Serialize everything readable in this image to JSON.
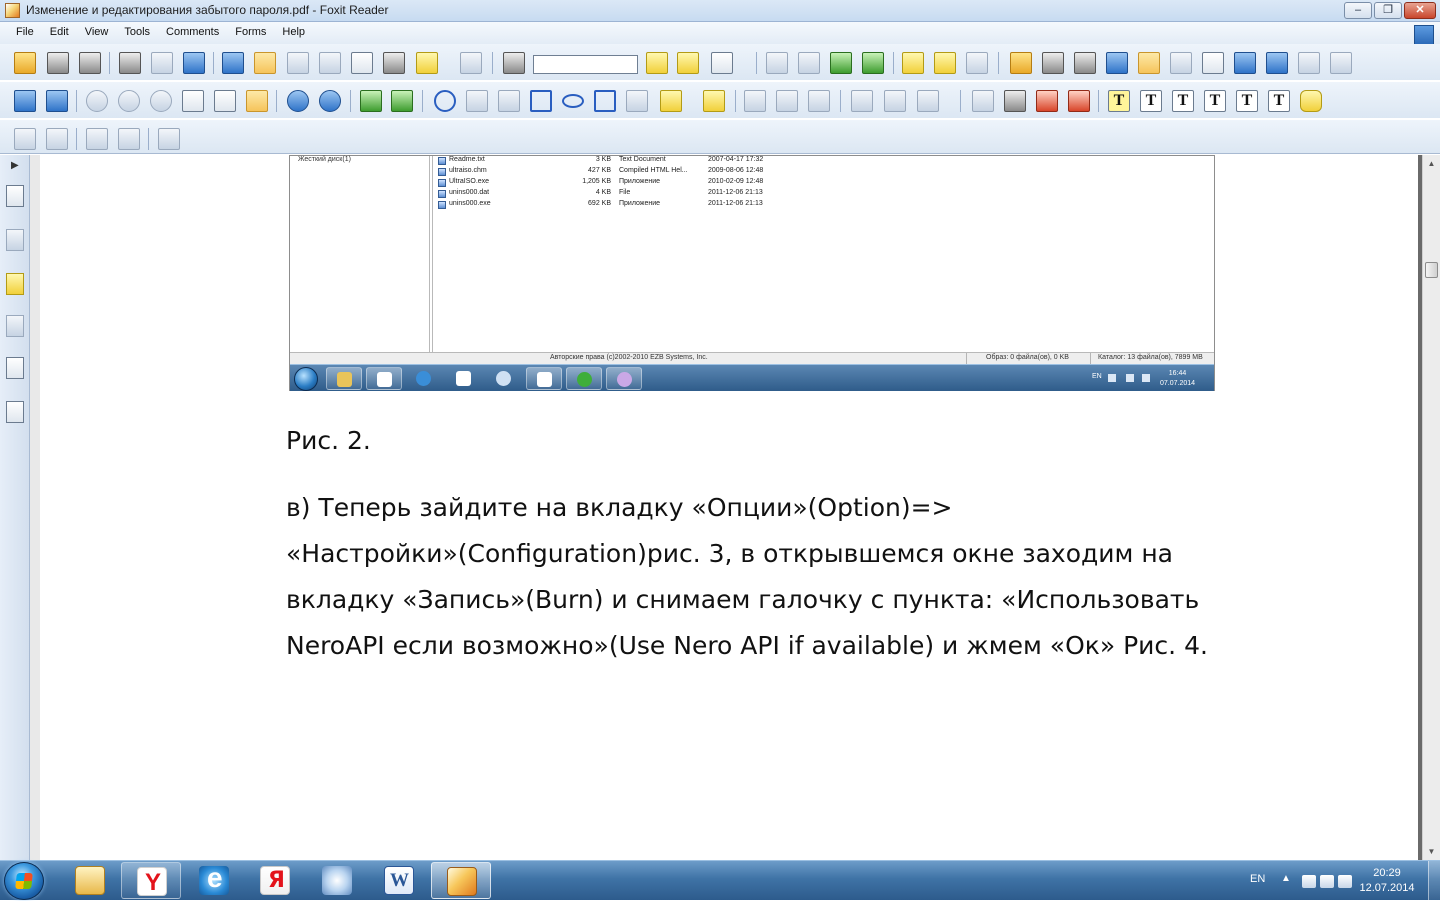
{
  "window": {
    "title": "Изменение и редактирования забытого пароля.pdf - Foxit Reader",
    "minimize": "–",
    "maximize": "❐",
    "close": "✕"
  },
  "menu": [
    "File",
    "Edit",
    "View",
    "Tools",
    "Comments",
    "Forms",
    "Help"
  ],
  "toolbar": {
    "search_value": "",
    "tool_icons": [
      "open-folder-icon",
      "save-icon",
      "save-all-icon",
      "print-icon",
      "email-icon",
      "facebook-icon",
      "monitor-icon",
      "hand-tool-icon",
      "snapshot-icon",
      "select-arrow-icon",
      "text-select-icon",
      "camera-icon",
      "rms-lock-icon",
      "sign-pen-icon",
      "binoculars-icon",
      "zoom-in-icon",
      "zoom-out-icon",
      "fit-page-icon",
      "rotate-icon",
      "circle-tool-icon",
      "arrow-tool-icon",
      "line-tool-icon",
      "rectangle-tool-icon",
      "oval-tool-icon",
      "polygon-tool-icon",
      "polyline-tool-icon",
      "pencil-tool-icon",
      "eraser-tool-icon",
      "typewriter-icon",
      "note-icon",
      "attachment-icon"
    ]
  },
  "text_tools": [
    "T",
    "T",
    "T",
    "T",
    "T",
    "T"
  ],
  "embedded_screenshot": {
    "tree_label": "Жесткий диск(1)",
    "files": [
      {
        "name": "Readme.txt",
        "size": "3 KB",
        "type": "Text Document",
        "date": "2007-04-17 17:32"
      },
      {
        "name": "ultraiso.chm",
        "size": "427 KB",
        "type": "Compiled HTML Hel...",
        "date": "2009-08-06 12:48"
      },
      {
        "name": "UltraISO.exe",
        "size": "1,205 KB",
        "type": "Приложение",
        "date": "2010-02-09 12:48"
      },
      {
        "name": "unins000.dat",
        "size": "4 KB",
        "type": "File",
        "date": "2011-12-06 21:13"
      },
      {
        "name": "unins000.exe",
        "size": "692 KB",
        "type": "Приложение",
        "date": "2011-12-06 21:13"
      }
    ],
    "status_copyright": "Авторские права (c)2002-2010 EZB Systems, Inc.",
    "status_image": "Образ: 0 файла(ов), 0 KB",
    "status_catalog": "Каталог: 13 файла(ов), 7899 MB",
    "tray_lang": "EN",
    "tray_time": "16:44",
    "tray_date": "07.07.2014"
  },
  "document": {
    "caption": "Рис. 2.",
    "paragraph_lines": [
      "в) Теперь зайдите на вкладку «Опции»(Option)=>",
      "«Настройки»(Configuration)рис. 3, в открывшемся окне заходим на",
      "вкладку «Запись»(Burn) и снимаем галочку с пункта: «Использовать",
      "NeroAPI если возможно»(Use Nero API if available) и жмем «Ок» Рис. 4."
    ]
  },
  "taskbar": {
    "apps": [
      "explorer",
      "yandex-browser",
      "internet-explorer",
      "yandex",
      "audio",
      "word",
      "foxit-reader"
    ],
    "lang": "EN",
    "time": "20:29",
    "date": "12.07.2014"
  }
}
